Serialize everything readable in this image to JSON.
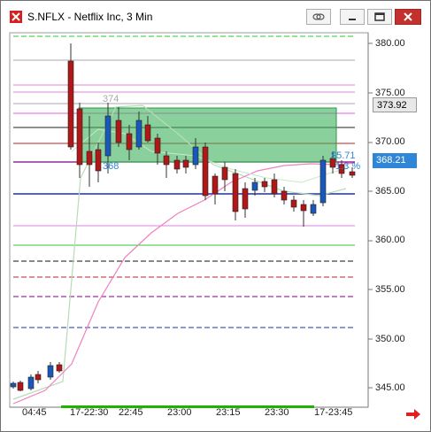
{
  "window": {
    "title": "S.NFLX - Netflix Inc, 3 Min"
  },
  "price_axis": {
    "labels": [
      "380.00",
      "375.00",
      "370.00",
      "365.00",
      "360.00",
      "355.00",
      "350.00",
      "345.00"
    ],
    "last_price": "373.92",
    "current_price": "368.21",
    "current_price_color": "#2f86d6"
  },
  "time_axis": {
    "labels": [
      "04:45",
      "17-22:30",
      "22:45",
      "23:00",
      "23:15",
      "23:30",
      "17-23:45"
    ]
  },
  "annotations": {
    "box_top_label": "374",
    "box_bottom_label": "368",
    "change_value": "$5.71",
    "change_pct": "1.3 %"
  },
  "icons": {
    "scroll_right": "red-arrow-right-icon"
  }
}
